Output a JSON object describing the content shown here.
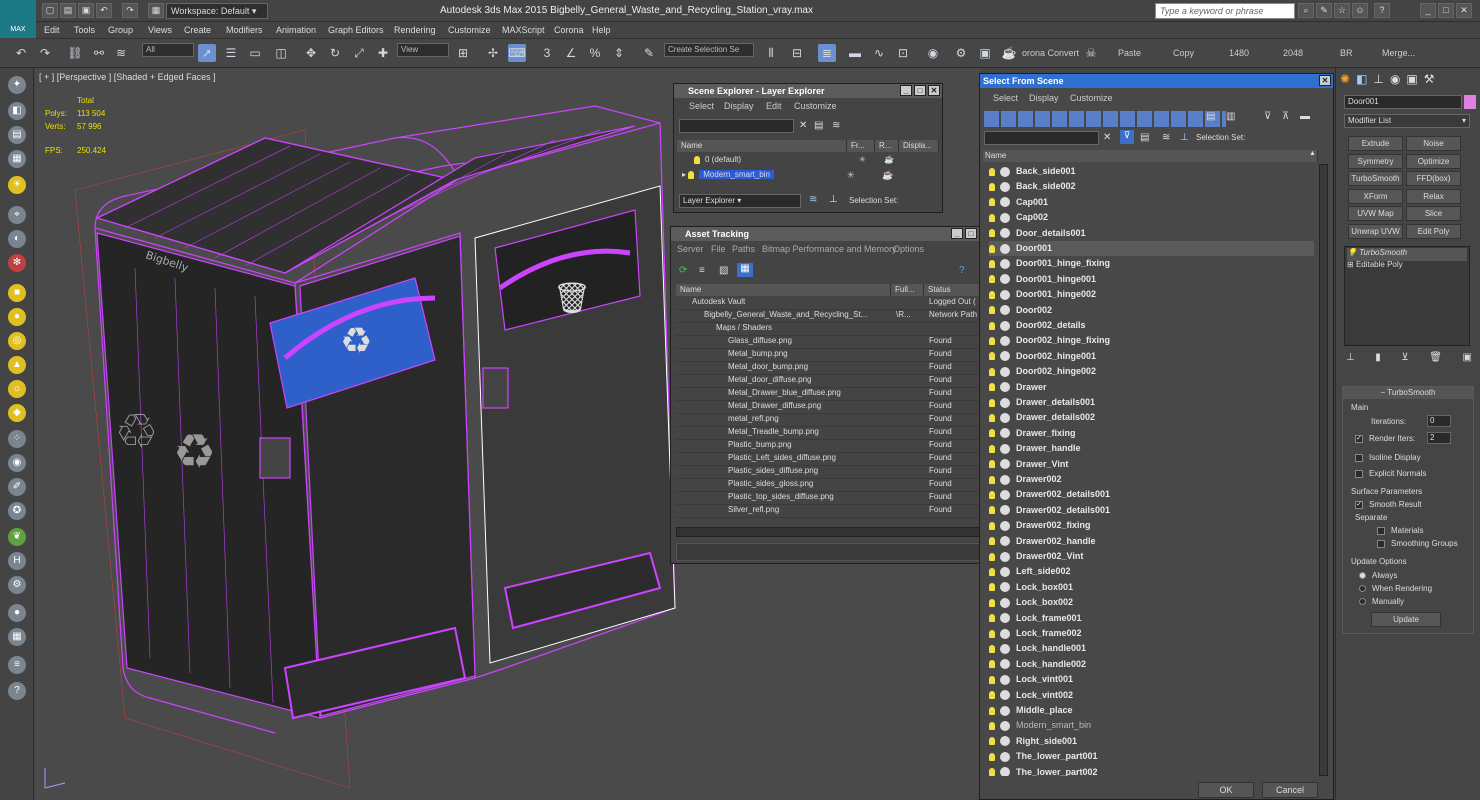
{
  "titlebar": {
    "title": "Autodesk 3ds Max  2015    Bigbelly_General_Waste_and_Recycling_Station_vray.max",
    "workspace": "Workspace: Default",
    "search_placeholder": "Type a keyword or phrase",
    "logo": "MAX"
  },
  "menu": [
    "Edit",
    "Tools",
    "Group",
    "Views",
    "Create",
    "Modifiers",
    "Animation",
    "Graph Editors",
    "Rendering",
    "Customize",
    "MAXScript",
    "Corona",
    "Help"
  ],
  "toolbar": {
    "filter": "All",
    "view": "View",
    "selection_set_placeholder": "Create Selection Se",
    "ref_coord": "3",
    "corona_convert": "orona Convert",
    "paste": "Paste",
    "copy": "Copy",
    "res_w": "1480",
    "res_h": "2048",
    "br": "BR",
    "merge": "Merge..."
  },
  "viewport": {
    "label": "[ + ] [Perspective ] [Shaded + Edged Faces ]",
    "stats": {
      "total_label": "Total",
      "polys_label": "Polys:",
      "polys": "113 504",
      "verts_label": "Verts:",
      "verts": "57 996",
      "fps_label": "FPS:",
      "fps": "250.424"
    },
    "brand_text": "Bigbelly"
  },
  "scene_explorer": {
    "title": "Scene Explorer - Layer Explorer",
    "menu": [
      "Select",
      "Display",
      "Edit",
      "Customize"
    ],
    "columns": [
      "Name",
      "Fr...",
      "R...",
      "Displa..."
    ],
    "rows": [
      "0 (default)",
      "Modern_smart_bin"
    ],
    "footer_dropdown": "Layer Explorer",
    "footer_label": "Selection Set:"
  },
  "asset_tracking": {
    "title": "Asset Tracking",
    "menu": [
      "Server",
      "File",
      "Paths",
      "Bitmap Performance and Memory",
      "Options"
    ],
    "columns": [
      "Name",
      "Full...",
      "Status"
    ],
    "rows": [
      {
        "name": "Autodesk Vault",
        "full": "",
        "status": "Logged Out (",
        "indent": 1
      },
      {
        "name": "Bigbelly_General_Waste_and_Recycling_St...",
        "full": "\\R...",
        "status": "Network Path",
        "indent": 2
      },
      {
        "name": "Maps / Shaders",
        "full": "",
        "status": "",
        "indent": 3
      },
      {
        "name": "Glass_diffuse.png",
        "full": "",
        "status": "Found",
        "indent": 4
      },
      {
        "name": "Metal_bump.png",
        "full": "",
        "status": "Found",
        "indent": 4
      },
      {
        "name": "Metal_door_bump.png",
        "full": "",
        "status": "Found",
        "indent": 4
      },
      {
        "name": "Metal_door_diffuse.png",
        "full": "",
        "status": "Found",
        "indent": 4
      },
      {
        "name": "Metal_Drawer_blue_diffuse.png",
        "full": "",
        "status": "Found",
        "indent": 4
      },
      {
        "name": "Metal_Drawer_diffuse.png",
        "full": "",
        "status": "Found",
        "indent": 4
      },
      {
        "name": "metal_refl.png",
        "full": "",
        "status": "Found",
        "indent": 4
      },
      {
        "name": "Metal_Treadle_bump.png",
        "full": "",
        "status": "Found",
        "indent": 4
      },
      {
        "name": "Plastic_bump.png",
        "full": "",
        "status": "Found",
        "indent": 4
      },
      {
        "name": "Plastic_Left_sides_diffuse.png",
        "full": "",
        "status": "Found",
        "indent": 4
      },
      {
        "name": "Plastic_sides_diffuse.png",
        "full": "",
        "status": "Found",
        "indent": 4
      },
      {
        "name": "Plastic_sides_gloss.png",
        "full": "",
        "status": "Found",
        "indent": 4
      },
      {
        "name": "Plastic_top_sides_diffuse.png",
        "full": "",
        "status": "Found",
        "indent": 4
      },
      {
        "name": "Silver_refl.png",
        "full": "",
        "status": "Found",
        "indent": 4
      }
    ]
  },
  "select_from_scene": {
    "title": "Select From Scene",
    "menu": [
      "Select",
      "Display",
      "Customize"
    ],
    "selection_set_label": "Selection Set:",
    "column": "Name",
    "selected": "Door001",
    "objects": [
      "Back_side001",
      "Back_side002",
      "Cap001",
      "Cap002",
      "Door_details001",
      "Door001",
      "Door001_hinge_fixing",
      "Door001_hinge001",
      "Door001_hinge002",
      "Door002",
      "Door002_details",
      "Door002_hinge_fixing",
      "Door002_hinge001",
      "Door002_hinge002",
      "Drawer",
      "Drawer_details001",
      "Drawer_details002",
      "Drawer_fixing",
      "Drawer_handle",
      "Drawer_Vint",
      "Drawer002",
      "Drawer002_details001",
      "Drawer002_details001",
      "Drawer002_fixing",
      "Drawer002_handle",
      "Drawer002_Vint",
      "Left_side002",
      "Lock_box001",
      "Lock_box002",
      "Lock_frame001",
      "Lock_frame002",
      "Lock_handle001",
      "Lock_handle002",
      "Lock_vint001",
      "Lock_vint002",
      "Middle_place",
      "Modern_smart_bin",
      "Right_side001",
      "The_lower_part001",
      "The_lower_part002"
    ],
    "ok": "OK",
    "cancel": "Cancel"
  },
  "command_panel": {
    "object_name": "Door001",
    "modifier_list": "Modifier List",
    "buttons": [
      "Extrude",
      "Noise",
      "Symmetry",
      "Optimize",
      "TurboSmooth",
      "FFD(box)",
      "XForm",
      "Relax",
      "UVW Map",
      "Slice",
      "Unwrap UVW",
      "Edit Poly"
    ],
    "stack": [
      "TurboSmooth",
      "Editable Poly"
    ],
    "rollout": {
      "title": "TurboSmooth",
      "main": "Main",
      "iterations_label": "Iterations:",
      "iterations": "0",
      "render_iters_label": "Render Iters:",
      "render_iters": "2",
      "isoline": "Isoline Display",
      "explicit_normals": "Explicit Normals",
      "surface_params": "Surface Parameters",
      "smooth_result": "Smooth Result",
      "separate": "Separate",
      "materials": "Materials",
      "smoothing_groups": "Smoothing Groups",
      "update_options": "Update Options",
      "always": "Always",
      "when_rendering": "When Rendering",
      "manually": "Manually",
      "update": "Update"
    }
  }
}
